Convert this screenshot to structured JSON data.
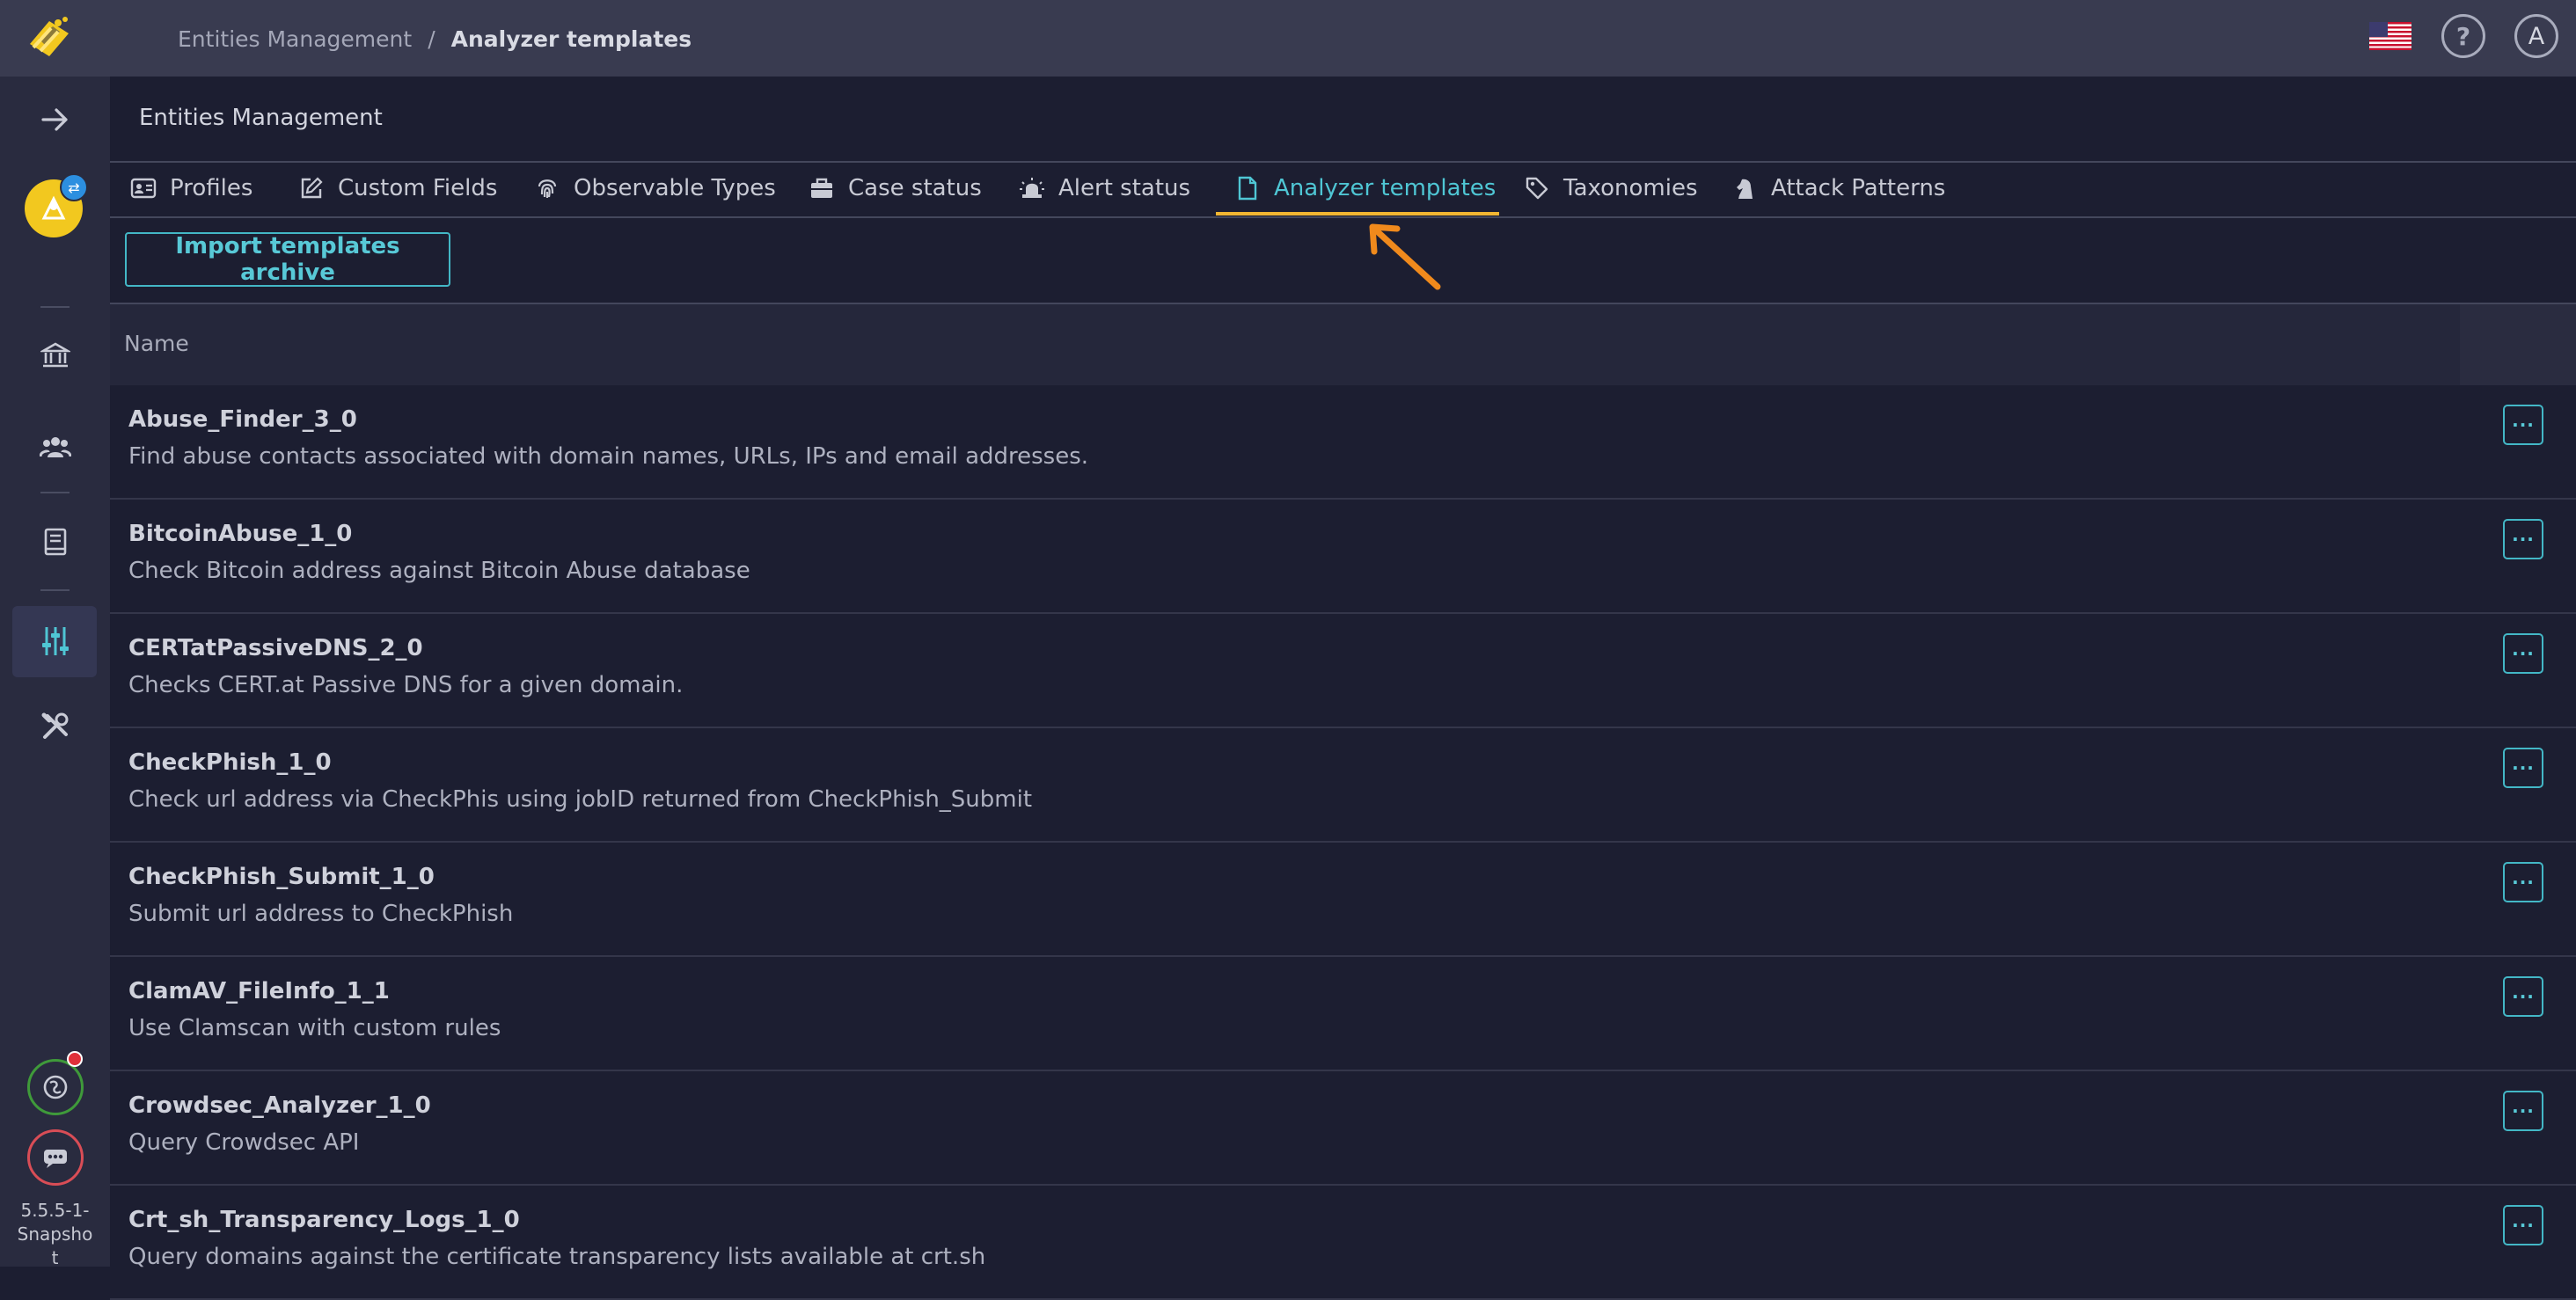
{
  "header": {
    "breadcrumb_parent": "Entities Management",
    "breadcrumb_separator": "/",
    "breadcrumb_current": "Analyzer templates",
    "help_label": "?",
    "avatar_initial": "A"
  },
  "sidebar": {
    "version": "5.5.5-1-Snapshot"
  },
  "page": {
    "title": "Entities Management"
  },
  "tabs": [
    {
      "label": "Profiles",
      "icon": "id-card-icon"
    },
    {
      "label": "Custom Fields",
      "icon": "edit-icon"
    },
    {
      "label": "Observable Types",
      "icon": "fingerprint-icon"
    },
    {
      "label": "Case status",
      "icon": "briefcase-icon"
    },
    {
      "label": "Alert status",
      "icon": "siren-icon"
    },
    {
      "label": "Analyzer templates",
      "icon": "file-icon",
      "active": true
    },
    {
      "label": "Taxonomies",
      "icon": "tag-icon"
    },
    {
      "label": "Attack Patterns",
      "icon": "chess-knight-icon"
    }
  ],
  "toolbar": {
    "import_label": "Import templates archive"
  },
  "table": {
    "column_name": "Name",
    "menu_label": "···",
    "rows": [
      {
        "name": "Abuse_Finder_3_0",
        "description": "Find abuse contacts associated with domain names, URLs, IPs and email addresses."
      },
      {
        "name": "BitcoinAbuse_1_0",
        "description": "Check Bitcoin address against Bitcoin Abuse database"
      },
      {
        "name": "CERTatPassiveDNS_2_0",
        "description": "Checks CERT.at Passive DNS for a given domain."
      },
      {
        "name": "CheckPhish_1_0",
        "description": "Check url address via CheckPhis using jobID returned from CheckPhish_Submit"
      },
      {
        "name": "CheckPhish_Submit_1_0",
        "description": "Submit url address to CheckPhish"
      },
      {
        "name": "ClamAV_FileInfo_1_1",
        "description": "Use Clamscan with custom rules"
      },
      {
        "name": "Crowdsec_Analyzer_1_0",
        "description": "Query Crowdsec API"
      },
      {
        "name": "Crt_sh_Transparency_Logs_1_0",
        "description": "Query domains against the certificate transparency lists available at crt.sh"
      }
    ]
  },
  "colors": {
    "accent": "#4fc6d4",
    "tab_underline": "#f2b632",
    "annotation_arrow": "#f08a1c"
  }
}
